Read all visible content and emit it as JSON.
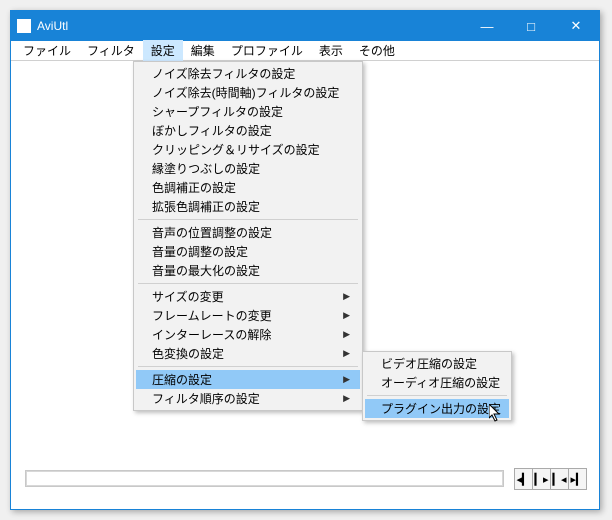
{
  "title": "AviUtl",
  "menubar": [
    "ファイル",
    "フィルタ",
    "設定",
    "編集",
    "プロファイル",
    "表示",
    "その他"
  ],
  "menubar_open_index": 2,
  "dropdown": {
    "groups": [
      [
        "ノイズ除去フィルタの設定",
        "ノイズ除去(時間軸)フィルタの設定",
        "シャープフィルタの設定",
        "ぼかしフィルタの設定",
        "クリッピング＆リサイズの設定",
        "縁塗りつぶしの設定",
        "色調補正の設定",
        "拡張色調補正の設定"
      ],
      [
        "音声の位置調整の設定",
        "音量の調整の設定",
        "音量の最大化の設定"
      ],
      [
        "サイズの変更",
        "フレームレートの変更",
        "インターレースの解除",
        "色変換の設定"
      ],
      [
        "圧縮の設定",
        "フィルタ順序の設定"
      ]
    ],
    "submenu_flags": [
      [
        false,
        false,
        false,
        false,
        false,
        false,
        false,
        false
      ],
      [
        false,
        false,
        false
      ],
      [
        true,
        true,
        true,
        true
      ],
      [
        true,
        true
      ]
    ],
    "highlighted": "圧縮の設定"
  },
  "submenu": {
    "items_top": [
      "ビデオ圧縮の設定",
      "オーディオ圧縮の設定"
    ],
    "items_bottom": [
      "プラグイン出力の設定"
    ],
    "highlighted": "プラグイン出力の設定"
  },
  "winbtns": {
    "min": "—",
    "max": "□",
    "close": "✕"
  },
  "player": {
    "prev": "◂▎",
    "next": "▎▸",
    "first": "▎◂",
    "last": "▸▎"
  }
}
